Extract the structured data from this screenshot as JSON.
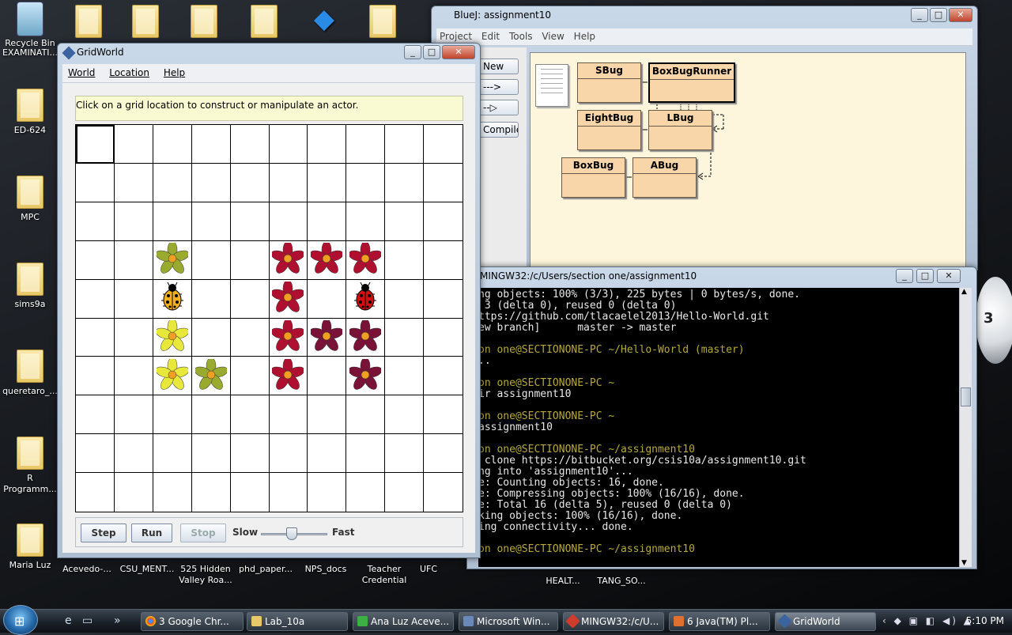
{
  "desktop_icons": [
    {
      "label": "Recycle Bin",
      "x": 0,
      "y": 0
    },
    {
      "label": "EXAMINATI...",
      "x": 0,
      "y": 0
    },
    {
      "label": "ED-624"
    },
    {
      "label": "MPC"
    },
    {
      "label": "sims9a"
    },
    {
      "label": "queretaro_..."
    },
    {
      "label": "R Programm..."
    },
    {
      "label": "Maria Luz"
    },
    {
      "label": "Acevedo-..."
    },
    {
      "label": "CSU_MENT..."
    },
    {
      "label": "525 Hidden Valley Roa..."
    },
    {
      "label": "phd_paper..."
    },
    {
      "label": "NPS_docs"
    },
    {
      "label": "Teacher Credential"
    },
    {
      "label": "UFC"
    },
    {
      "label": "HEALT..."
    },
    {
      "label": "TANG_SO..."
    }
  ],
  "gridworld": {
    "title": "GridWorld",
    "menu": [
      "World",
      "Location",
      "Help"
    ],
    "message": "Click on a grid location to construct or manipulate an actor.",
    "buttons": {
      "step": "Step",
      "run": "Run",
      "stop": "Stop"
    },
    "slider": {
      "slow": "Slow",
      "fast": "Fast",
      "level": 0.5
    },
    "colors": {
      "yellow_green": "#9aaa2e",
      "yellow": "#e8e83a",
      "crimson": "#b01030",
      "maroon": "#7a1238",
      "bug_yellow": "#f0b020",
      "bug_red": "#d01010"
    }
  },
  "bluej": {
    "title": "BlueJ:  assignment10",
    "menu": [
      "Project",
      "Edit",
      "Tools",
      "View",
      "Help"
    ],
    "side_buttons": [
      "New Class...",
      "--->",
      "--▷",
      "Compile"
    ],
    "classes": [
      "SBug",
      "BoxBugRunner",
      "EightBug",
      "LBug",
      "BoxBug",
      "ABug"
    ]
  },
  "mingw": {
    "title": "MINGW32:/c/Users/section one/assignment10",
    "lines": [
      {
        "text": "ng objects: 100% (3/3), 225 bytes | 0 bytes/s, done.",
        "c": "w"
      },
      {
        "text": " 3 (delta 0), reused 0 (delta 0)",
        "c": "w"
      },
      {
        "text": "ttps://github.com/tlacaelel2013/Hello-World.git",
        "c": "w"
      },
      {
        "text": "ew branch]      master -> master",
        "c": "w"
      },
      {
        "text": "",
        "c": "w"
      },
      {
        "text": "on one@SECTIONONE-PC ~/Hello-World (master)",
        "c": "g"
      },
      {
        "text": "..",
        "c": "w"
      },
      {
        "text": "",
        "c": "w"
      },
      {
        "text": "on one@SECTIONONE-PC ~",
        "c": "g"
      },
      {
        "text": "ir assignment10",
        "c": "w"
      },
      {
        "text": "",
        "c": "w"
      },
      {
        "text": "on one@SECTIONONE-PC ~",
        "c": "g"
      },
      {
        "text": "assignment10",
        "c": "w"
      },
      {
        "text": "",
        "c": "w"
      },
      {
        "text": "on one@SECTIONONE-PC ~/assignment10",
        "c": "g"
      },
      {
        "text": " clone https://bitbucket.org/csis10a/assignment10.git",
        "c": "w"
      },
      {
        "text": "ng into 'assignment10'...",
        "c": "w"
      },
      {
        "text": "e: Counting objects: 16, done.",
        "c": "w"
      },
      {
        "text": "e: Compressing objects: 100% (16/16), done.",
        "c": "w"
      },
      {
        "text": "e: Total 16 (delta 5), reused 0 (delta 0)",
        "c": "w"
      },
      {
        "text": "king objects: 100% (16/16), done.",
        "c": "w"
      },
      {
        "text": "ing connectivity... done.",
        "c": "w"
      },
      {
        "text": "",
        "c": "w"
      },
      {
        "text": "on one@SECTIONONE-PC ~/assignment10",
        "c": "g"
      }
    ]
  },
  "taskbar": {
    "items": [
      "3 Google Chr...",
      "Lab_10a",
      "Ana Luz Aceve...",
      "Microsoft Win...",
      "MINGW32:/c/U...",
      "6 Java(TM) Pl...",
      "GridWorld"
    ],
    "time": "5:10 PM"
  }
}
